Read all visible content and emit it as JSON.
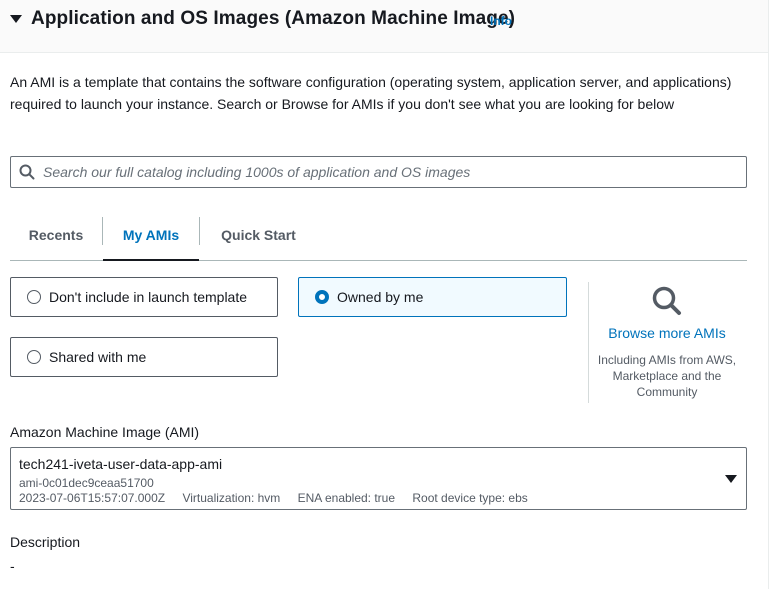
{
  "header": {
    "title": "Application and OS Images (Amazon Machine Image)",
    "info_link": "Info",
    "collapse_icon": "caret-down-icon"
  },
  "description": "An AMI is a template that contains the software configuration (operating system, application server, and applications) required to launch your instance. Search or Browse for AMIs if you don't see what you are looking for below",
  "search": {
    "placeholder": "Search our full catalog including 1000s of application and OS images",
    "value": "",
    "icon": "search-icon"
  },
  "tabs": [
    {
      "label": "Recents",
      "active": false
    },
    {
      "label": "My AMIs",
      "active": true
    },
    {
      "label": "Quick Start",
      "active": false
    }
  ],
  "ownership_options": [
    {
      "label": "Don't include in launch template",
      "selected": false
    },
    {
      "label": "Owned by me",
      "selected": true
    },
    {
      "label": "Shared with me",
      "selected": false
    }
  ],
  "browse": {
    "icon": "magnifier-icon",
    "link": "Browse more AMIs",
    "note": "Including AMIs from AWS, Marketplace and the Community"
  },
  "ami": {
    "label": "Amazon Machine Image (AMI)",
    "name": "tech241-iveta-user-data-app-ami",
    "id": "ami-0c01dec9ceaa51700",
    "created": "2023-07-06T15:57:07.000Z",
    "virtualization": "Virtualization: hvm",
    "ena": "ENA enabled: true",
    "root_device": "Root device type: ebs"
  },
  "ami_description": {
    "label": "Description",
    "value": "-"
  },
  "colors": {
    "accent": "#0073bb",
    "text": "#16191f",
    "muted": "#545b64",
    "selected_bg": "#f1faff"
  }
}
